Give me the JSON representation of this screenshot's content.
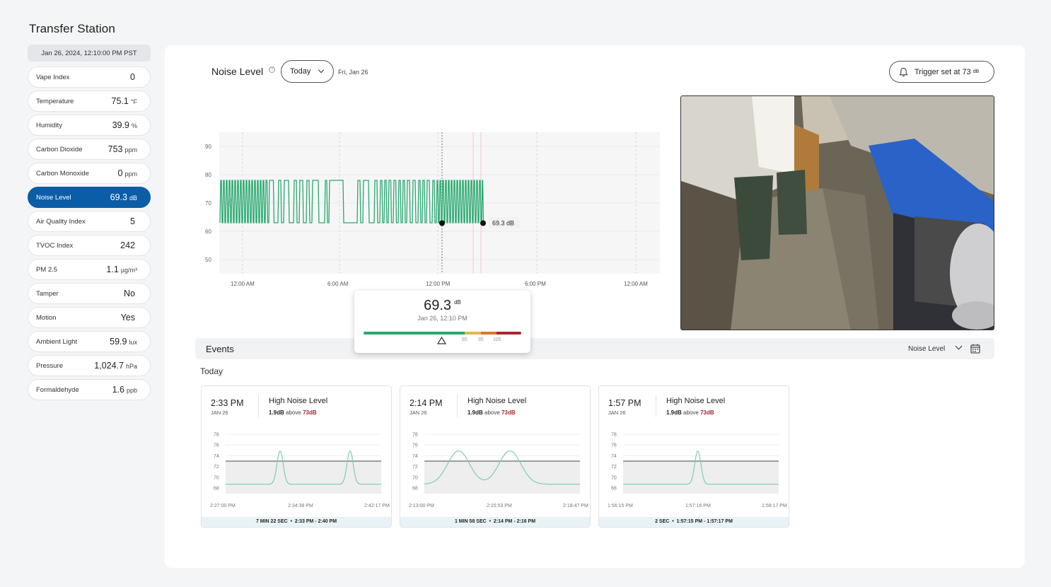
{
  "station": {
    "title": "Transfer Station",
    "timestamp": "Jan 26, 2024, 12:10:00 PM PST"
  },
  "sensors": [
    {
      "label": "Vape Index",
      "value": "0",
      "unit": ""
    },
    {
      "label": "Temperature",
      "value": "75.1",
      "unit": "°F"
    },
    {
      "label": "Humidity",
      "value": "39.9",
      "unit": "%"
    },
    {
      "label": "Carbon Dioxide",
      "value": "753",
      "unit": "ppm"
    },
    {
      "label": "Carbon Monoxide",
      "value": "0",
      "unit": "ppm"
    },
    {
      "label": "Noise Level",
      "value": "69.3",
      "unit": "dB",
      "active": true
    },
    {
      "label": "Air Quality Index",
      "value": "5",
      "unit": ""
    },
    {
      "label": "TVOC Index",
      "value": "242",
      "unit": ""
    },
    {
      "label": "PM 2.5",
      "value": "1.1",
      "unit": "µg/m³"
    },
    {
      "label": "Tamper",
      "value": "No",
      "unit": ""
    },
    {
      "label": "Motion",
      "value": "Yes",
      "unit": ""
    },
    {
      "label": "Ambient Light",
      "value": "59.9",
      "unit": "lux"
    },
    {
      "label": "Pressure",
      "value": "1,024.7",
      "unit": "hPa"
    },
    {
      "label": "Formaldehyde",
      "value": "1.6",
      "unit": "ppb"
    }
  ],
  "header": {
    "title": "Noise Level",
    "range_select": "Today",
    "date": "Fri, Jan 26",
    "trigger_label": "Trigger set at 73",
    "trigger_unit": "dB"
  },
  "colors": {
    "accent": "#0b5da8",
    "series": "#27a96e",
    "threshold": "#a8262f"
  },
  "tooltip": {
    "value": "69.3",
    "unit": "dB",
    "date": "Jan 26, 12:10 PM",
    "ticks": [
      "85",
      "95",
      "105"
    ]
  },
  "chart_data": {
    "type": "line",
    "yticks": [
      "90",
      "80",
      "70",
      "60",
      "50"
    ],
    "xticks": [
      "12:00 AM",
      "6:00 AM",
      "12:00 PM",
      "6:00 PM",
      "12:00 AM"
    ],
    "ylim": [
      45,
      95
    ],
    "current_label": "69.3 dB",
    "series": [
      {
        "values": [
          63,
          78,
          63,
          78,
          63,
          78,
          63,
          78,
          63,
          78,
          63,
          78,
          63,
          78,
          63,
          78,
          63
        ]
      }
    ]
  },
  "events": {
    "title": "Events",
    "filter": "Noise Level",
    "section": "Today",
    "items": [
      {
        "time": "2:33 PM",
        "day": "JAN 26",
        "type": "High Noise Level",
        "delta": "1.9dB",
        "above": "above",
        "threshold": "73dB",
        "yticks": [
          "78",
          "76",
          "74",
          "72",
          "70",
          "68"
        ],
        "xticks": [
          "2:27:00 PM",
          "2:34:38 PM",
          "2:42:17 PM"
        ],
        "footer_duration": "7 MIN 22 SEC",
        "footer_range": "2:33 PM - 2:40 PM",
        "chart_data": {
          "type": "line",
          "ylim": [
            68,
            78
          ],
          "threshold": 73,
          "peaks": [
            {
              "x": 0.35,
              "y": 74.9
            },
            {
              "x": 0.8,
              "y": 74.9
            }
          ],
          "base": 68.7
        }
      },
      {
        "time": "2:14 PM",
        "day": "JAN 26",
        "type": "High Noise Level",
        "delta": "1.9dB",
        "above": "above",
        "threshold": "73dB",
        "yticks": [
          "78",
          "76",
          "74",
          "72",
          "70",
          "68"
        ],
        "xticks": [
          "2:13:00 PM",
          "2:15:53 PM",
          "2:18:47 PM"
        ],
        "footer_duration": "1 MIN 58 SEC",
        "footer_range": "2:14 PM - 2:16 PM",
        "chart_data": {
          "type": "line",
          "ylim": [
            68,
            78
          ],
          "threshold": 73,
          "peaks": [
            {
              "x": 0.22,
              "y": 74.9
            },
            {
              "x": 0.55,
              "y": 74.9
            }
          ],
          "base": 68.7,
          "wide": true
        }
      },
      {
        "time": "1:57 PM",
        "day": "JAN 26",
        "type": "High Noise Level",
        "delta": "1.9dB",
        "above": "above",
        "threshold": "73dB",
        "yticks": [
          "78",
          "76",
          "74",
          "72",
          "70",
          "68"
        ],
        "xticks": [
          "1:56:15 PM",
          "1:57:16 PM",
          "1:58:17 PM"
        ],
        "footer_duration": "2 SEC",
        "footer_range": "1:57:15 PM - 1:57:17 PM",
        "chart_data": {
          "type": "line",
          "ylim": [
            68,
            78
          ],
          "threshold": 73,
          "peaks": [
            {
              "x": 0.48,
              "y": 74.9
            }
          ],
          "base": 68.7
        }
      }
    ]
  }
}
